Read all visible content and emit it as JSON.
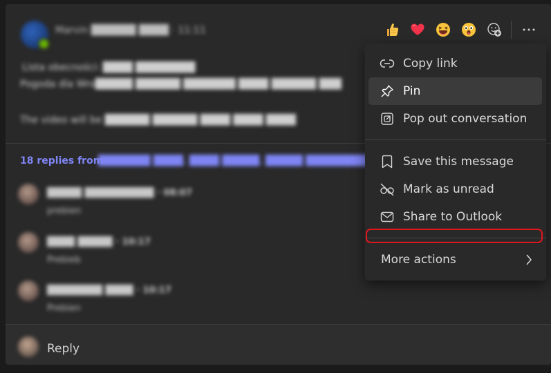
{
  "message": {
    "author": "Marvin ██████ ████ · 11:11",
    "body_lines": [
      "Lista obecności: ████ ████████",
      "Pogoda dla Wro█████ ██████ ███████ ████ ██████ ███",
      "The video will be ██████ ██████ ████ ████ ████"
    ]
  },
  "thread": {
    "replies_count": "18 replies from",
    "replies_names": "███████ ████, ████ █████, █████ ██████████, ...",
    "replies": [
      {
        "name": "█████ ██████████ · 08:07",
        "text": "prebien"
      },
      {
        "name": "████ █████ · 10:17",
        "text": "Prebieb"
      },
      {
        "name": "████████ ████ · 10:17",
        "text": "Prebien"
      }
    ]
  },
  "reply_bar": {
    "label": "Reply"
  },
  "reactions": [
    {
      "icon": "thumbs-up-icon"
    },
    {
      "icon": "heart-icon"
    },
    {
      "icon": "laughing-face-icon"
    },
    {
      "icon": "surprised-face-icon"
    },
    {
      "icon": "add-reaction-icon"
    }
  ],
  "menu": {
    "copy_link": "Copy link",
    "pin": "Pin",
    "pop_out": "Pop out conversation",
    "save": "Save this message",
    "mark_unread": "Mark as unread",
    "share_outlook": "Share to Outlook",
    "more_actions": "More actions"
  },
  "colors": {
    "accent_link": "#7f85f5",
    "highlight_box": "#e0161e",
    "menu_bg": "#292929",
    "hover_bg": "#3b3b3b"
  }
}
